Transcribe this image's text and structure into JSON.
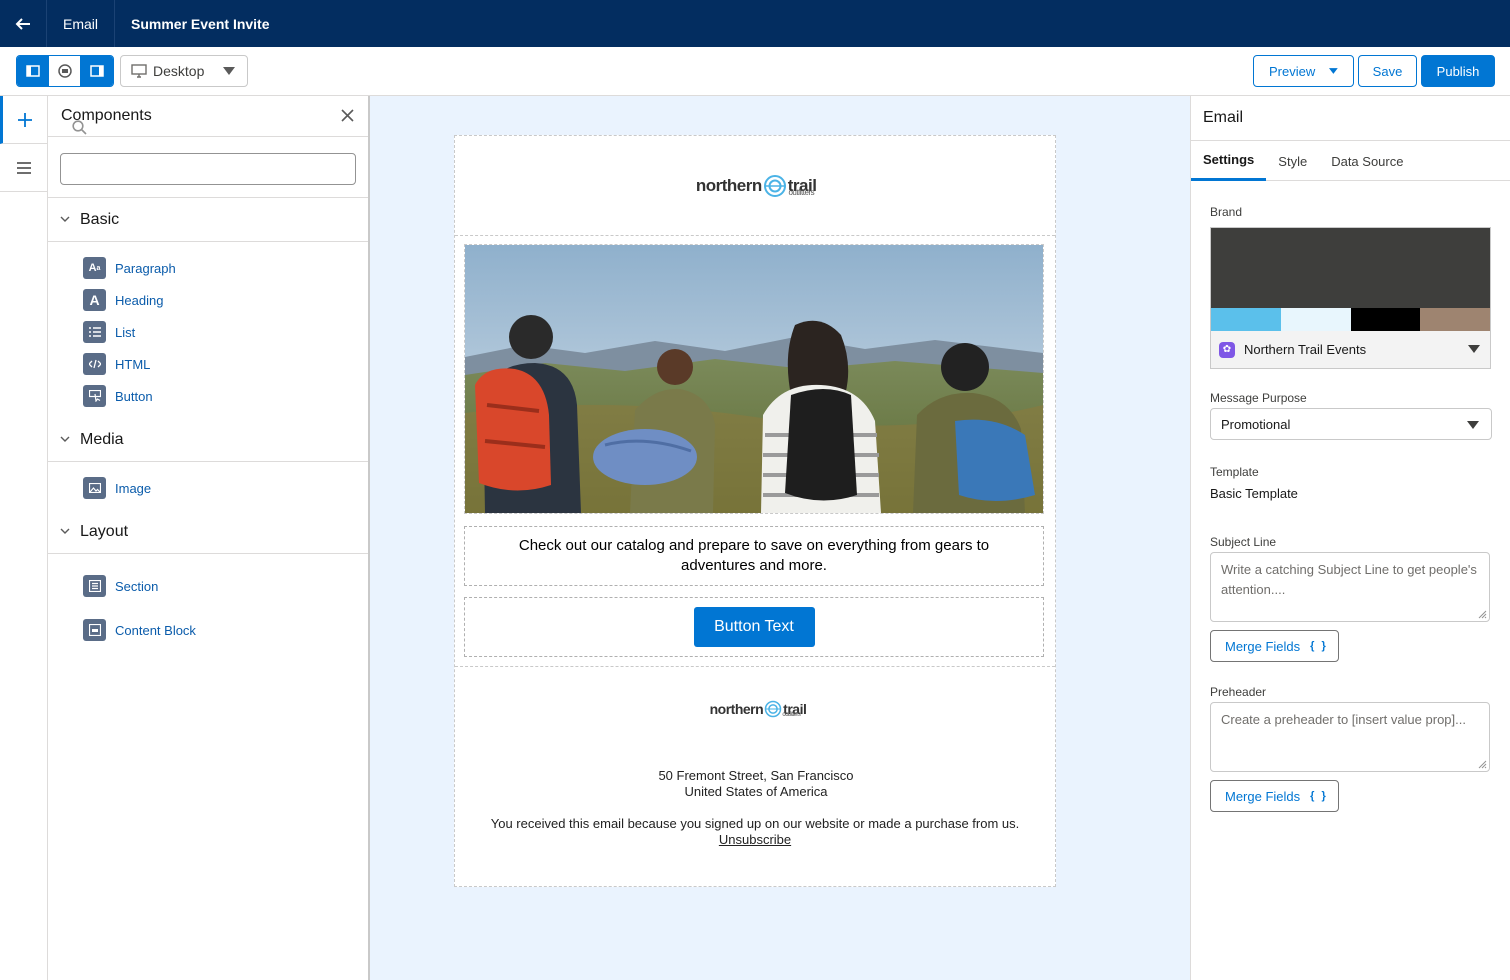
{
  "topbar": {
    "app": "Email",
    "title": "Summer Event Invite"
  },
  "toolbar": {
    "device": "Desktop",
    "preview": "Preview",
    "save": "Save",
    "publish": "Publish"
  },
  "components": {
    "title": "Components",
    "search_placeholder": "",
    "sections": {
      "basic": {
        "label": "Basic",
        "items": [
          "Paragraph",
          "Heading",
          "List",
          "HTML",
          "Button"
        ]
      },
      "media": {
        "label": "Media",
        "items": [
          "Image"
        ]
      },
      "layout": {
        "label": "Layout",
        "items": [
          "Section",
          "Content Block"
        ]
      }
    }
  },
  "email": {
    "logo_main": "northern",
    "logo_trail": "trail",
    "logo_sub": "outfitters",
    "body_text": "Check out our catalog and prepare to save on everything from gears to adventures and more.",
    "button_text": "Button Text",
    "address_line1": "50 Fremont Street, San Francisco",
    "address_line2": "United States of America",
    "disclaimer": "You received this email because you signed up on our website or made a purchase from us.",
    "unsubscribe": "Unsubscribe"
  },
  "settings": {
    "title": "Email",
    "tabs": [
      "Settings",
      "Style",
      "Data Source"
    ],
    "brand_label": "Brand",
    "brand_name": "Northern Trail Events",
    "brand_colors": [
      "#3e3e3c",
      "#5bc0eb",
      "#e8f6fd",
      "#000000",
      "#9e8470"
    ],
    "purpose_label": "Message Purpose",
    "purpose_value": "Promotional",
    "template_label": "Template",
    "template_value": "Basic Template",
    "subject_label": "Subject Line",
    "subject_placeholder": "Write a catching Subject Line to get people's attention....",
    "merge_label": "Merge Fields",
    "preheader_label": "Preheader",
    "preheader_placeholder": "Create a preheader to [insert value prop]..."
  }
}
